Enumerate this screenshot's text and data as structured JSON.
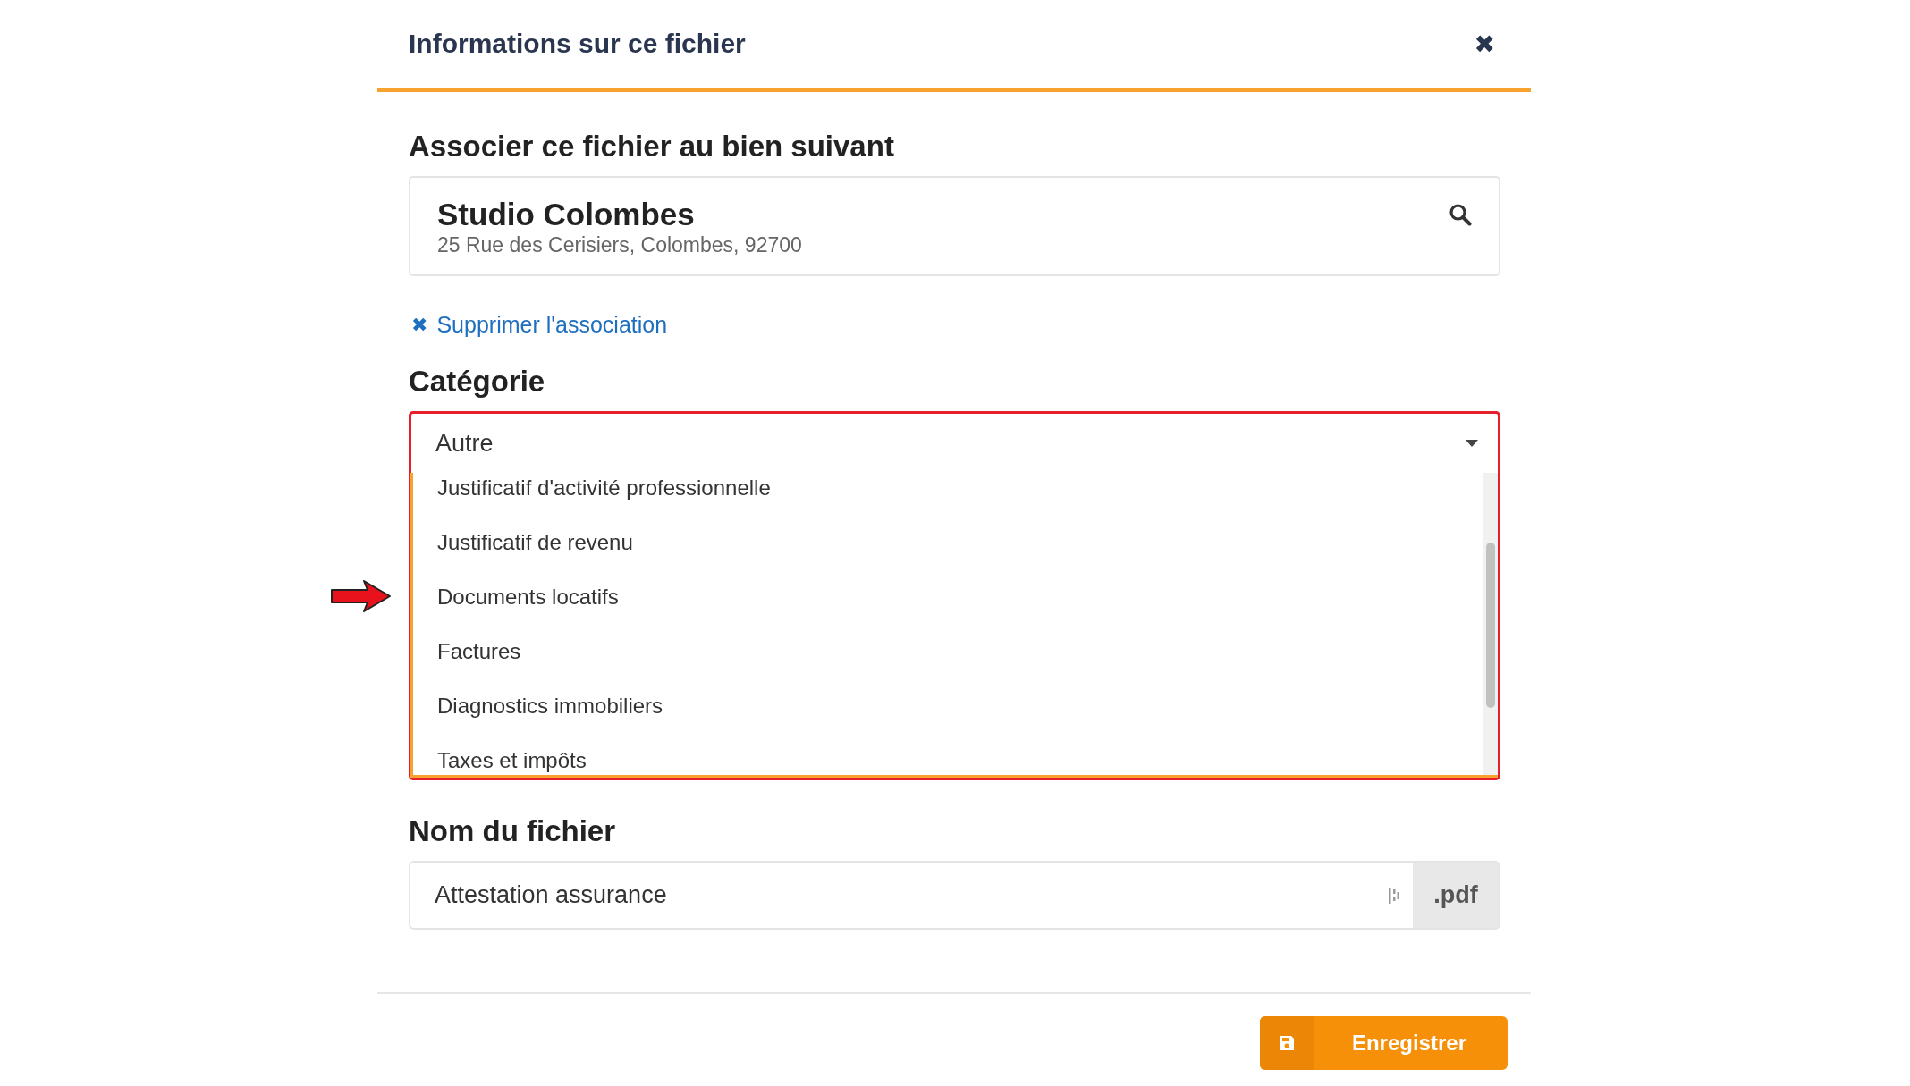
{
  "dialog": {
    "title": "Informations sur ce fichier",
    "close": "✖"
  },
  "property": {
    "heading": "Associer ce fichier au bien suivant",
    "name": "Studio Colombes",
    "address": "25 Rue des Cerisiers, Colombes, 92700",
    "remove_link": "Supprimer l'association",
    "remove_icon": "✖"
  },
  "category": {
    "heading": "Catégorie",
    "value": "Autre",
    "expanded": true,
    "annotated": true,
    "options": [
      {
        "label": "Justificatif d'activité professionnelle",
        "selected": false,
        "pointed": false
      },
      {
        "label": "Justificatif de revenu",
        "selected": false,
        "pointed": false
      },
      {
        "label": "Documents locatifs",
        "selected": false,
        "pointed": true
      },
      {
        "label": "Factures",
        "selected": false,
        "pointed": false
      },
      {
        "label": "Diagnostics immobiliers",
        "selected": false,
        "pointed": false
      },
      {
        "label": "Taxes et impôts",
        "selected": false,
        "pointed": false
      }
    ]
  },
  "filename": {
    "heading": "Nom du fichier",
    "value": "Attestation assurance",
    "extension": ".pdf"
  },
  "footer": {
    "save_button": "Enregistrer"
  }
}
